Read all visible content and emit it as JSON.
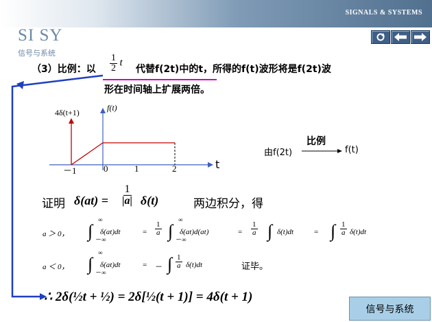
{
  "header": {
    "brand": "SIGNALS & SYSTEMS"
  },
  "logo": {
    "main": "SI SY",
    "sub": "信号与系统"
  },
  "nav": {
    "buttons": [
      "refresh-icon",
      "arrow-left-icon",
      "arrow-right-icon"
    ]
  },
  "statement": {
    "prefix": "（3）比例：以",
    "frac_num": "1",
    "frac_den": "2",
    "var": "t",
    "mid": "代替f(2t)中的t，所得的f(t)波形将是f(2t)波",
    "line2": "形在时间轴上扩展两倍。"
  },
  "graph": {
    "impulse_label": "4δ(t+1)",
    "y_label": "f(t)",
    "x_axis_label": "t",
    "ticks": [
      "－1",
      "0",
      "1",
      "2"
    ]
  },
  "transform": {
    "top": "比例",
    "from": "由f(2t)",
    "to": "f(t)"
  },
  "proof": {
    "label": "证明",
    "lhs": "δ(at) =",
    "frac_num": "1",
    "frac_den": "|a|",
    "rhs": "δ(t)",
    "note": "两边积分，得",
    "case1": {
      "cond": "a ＞ 0，",
      "t1": "δ(at)dt",
      "t2": "δ(at)d(at)",
      "t3": "δ(t)dt",
      "t4": "δ(t)dt"
    },
    "case2": {
      "cond": "a ＜ 0，",
      "t1": "δ(at)dt",
      "t2": "δ(t)dt",
      "done": "证毕。"
    },
    "conclusion": "∴ 2δ(½t + ½) = 2δ[½(t + 1)] = 4δ(t + 1)"
  },
  "footer": {
    "label": "信号与系统"
  },
  "colors": {
    "accent_blue": "#1f3fbf",
    "graph_red": "#c00000",
    "axis_blue": "#3f5fbf",
    "underline_magenta": "#d000c0"
  }
}
